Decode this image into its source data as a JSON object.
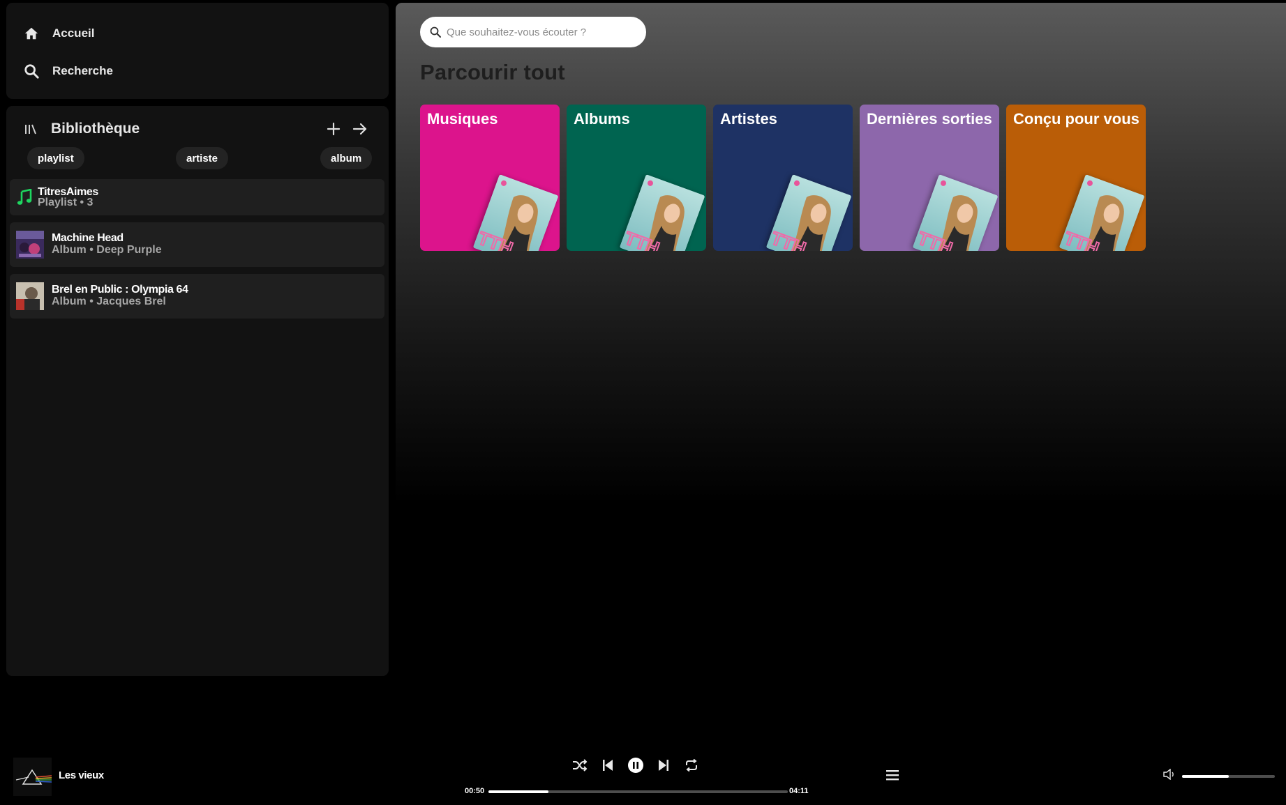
{
  "nav": {
    "home_label": "Accueil",
    "search_label": "Recherche"
  },
  "library": {
    "title": "Bibliothèque",
    "filters": [
      "playlist",
      "artiste",
      "album"
    ],
    "items": [
      {
        "title": "TitresAimes",
        "subtitle": "Playlist • 3",
        "icon": "music-note-icon"
      },
      {
        "title": "Machine Head",
        "subtitle": "Album • Deep Purple",
        "icon": "album-cover"
      },
      {
        "title": "Brel en Public : Olympia 64",
        "subtitle": "Album • Jacques Brel",
        "icon": "album-cover"
      }
    ]
  },
  "search": {
    "placeholder": "Que souhaitez-vous écouter ?",
    "value": ""
  },
  "browse": {
    "title": "Parcourir tout",
    "categories": [
      {
        "label": "Musiques",
        "color": "#dc148c"
      },
      {
        "label": "Albums",
        "color": "#006450"
      },
      {
        "label": "Artistes",
        "color": "#1e3264"
      },
      {
        "label": "Dernières sorties",
        "color": "#8d67ab"
      },
      {
        "label": "Conçu pour vous",
        "color": "#ba5d07"
      }
    ]
  },
  "player": {
    "track_title": "Les vieux",
    "current_time": "00:50",
    "total_time": "04:11",
    "progress_fraction": 0.2,
    "volume_fraction": 0.5
  },
  "colors": {
    "accent": "#1ed760",
    "panel": "#121212",
    "item_bg": "#1f1f1f"
  }
}
